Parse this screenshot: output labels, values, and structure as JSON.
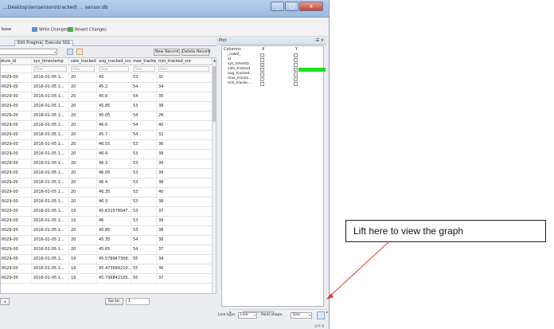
{
  "window": {
    "title": "...Desktop\\lan\\sensors\\tracked\\ ... sensor.db",
    "min_glyph": "_",
    "max_glyph": "□",
    "close_glyph": "x"
  },
  "toolbar": {
    "partial_label": "base",
    "write_changes": "Write Changes",
    "revert_changes": "Revert Changes"
  },
  "tabs": [
    {
      "label": "Edit Pragmas"
    },
    {
      "label": "Execute SQL"
    }
  ],
  "data_toolbar": {
    "new_record": "New Record",
    "delete_record": "Delete Record",
    "combo_arrow": "▾"
  },
  "grid": {
    "columns": [
      "ature_id",
      "sys_timestamp",
      "sats_tracked",
      "avg_tracked_snr",
      "max_tracked_snr",
      "min_tracked_snr"
    ],
    "filter_placeholder": "Filter",
    "scroll_up": "▲",
    "rows": [
      [
        "-0029-00",
        "2016-01-05 1...",
        "20",
        "45",
        "53",
        "31"
      ],
      [
        "-0029-00",
        "2016-01-05 1...",
        "20",
        "45.2",
        "54",
        "34"
      ],
      [
        "-0029-00",
        "2016-01-05 1...",
        "20",
        "45.6",
        "54",
        "35"
      ],
      [
        "-0029-00",
        "2016-01-05 1...",
        "20",
        "45.85",
        "53",
        "38"
      ],
      [
        "-0029-00",
        "2016-01-05 1...",
        "20",
        "45.05",
        "54",
        "26"
      ],
      [
        "-0029-00",
        "2016-01-05 1...",
        "20",
        "46.6",
        "54",
        "40"
      ],
      [
        "-0029-00",
        "2016-01-05 1...",
        "20",
        "45.7",
        "54",
        "32"
      ],
      [
        "-0029-00",
        "2016-01-05 1...",
        "20",
        "46.55",
        "53",
        "36"
      ],
      [
        "-0029-00",
        "2016-01-05 1...",
        "20",
        "46.4",
        "53",
        "38"
      ],
      [
        "-0029-00",
        "2016-01-05 1...",
        "20",
        "46.3",
        "53",
        "39"
      ],
      [
        "-0029-00",
        "2016-01-05 1...",
        "20",
        "46.05",
        "53",
        "39"
      ],
      [
        "-0029-00",
        "2016-01-05 1...",
        "20",
        "46.4",
        "53",
        "38"
      ],
      [
        "-0029-00",
        "2016-01-05 1...",
        "20",
        "46.35",
        "53",
        "40"
      ],
      [
        "-0029-00",
        "2016-01-05 1...",
        "20",
        "46.3",
        "53",
        "38"
      ],
      [
        "-0029-00",
        "2016-01-05 1...",
        "19",
        "45.631578947...",
        "53",
        "37"
      ],
      [
        "-0029-00",
        "2016-01-05 1...",
        "19",
        "46",
        "53",
        "39"
      ],
      [
        "-0029-00",
        "2016-01-05 1...",
        "20",
        "45.85",
        "53",
        "38"
      ],
      [
        "-0029-00",
        "2016-01-05 1...",
        "20",
        "45.35",
        "54",
        "38"
      ],
      [
        "-0029-00",
        "2016-01-05 1...",
        "20",
        "45.65",
        "54",
        "37"
      ],
      [
        "-0029-00",
        "2016-01-05 1...",
        "19",
        "45.578947368...",
        "55",
        "34"
      ],
      [
        "-0029-00",
        "2016-01-05 1...",
        "19",
        "45.473684210...",
        "55",
        "36"
      ],
      [
        "-0029-00",
        "2016-01-05 1...",
        "19",
        "45.736842105...",
        "55",
        "37"
      ]
    ]
  },
  "pager": {
    "prev_label": "◂",
    "goto_label": "Go to:",
    "goto_value": "1"
  },
  "plot": {
    "title": "Plot",
    "close_label": "☰ ×",
    "headers": {
      "columns": "Columns",
      "x": "X",
      "y": "Y"
    },
    "columns": [
      {
        "name": "_rowid_",
        "x": false,
        "y": false,
        "color": ""
      },
      {
        "name": "id",
        "x": false,
        "y": false,
        "color": ""
      },
      {
        "name": "sys_timesta...",
        "x": true,
        "y": false,
        "color": ""
      },
      {
        "name": "sats_tracked",
        "x": false,
        "y": true,
        "color": "#22dd22"
      },
      {
        "name": "avg_tracked...",
        "x": false,
        "y": false,
        "color": ""
      },
      {
        "name": "max_tracke...",
        "x": false,
        "y": false,
        "color": ""
      },
      {
        "name": "min_tracke...",
        "x": false,
        "y": false,
        "color": ""
      }
    ],
    "check_glyph": "✓",
    "scroll_left": "◂",
    "scroll_right": "▸",
    "line_type_label": "Line type:",
    "line_type_value": "Line",
    "point_shape_label": "Point shape:",
    "point_shape_value": "Disc",
    "select_arrow": "▾",
    "encoding": "UTF-8"
  },
  "annotation": {
    "text": "Lift here to view the graph",
    "arrow_color": "#e53935"
  }
}
